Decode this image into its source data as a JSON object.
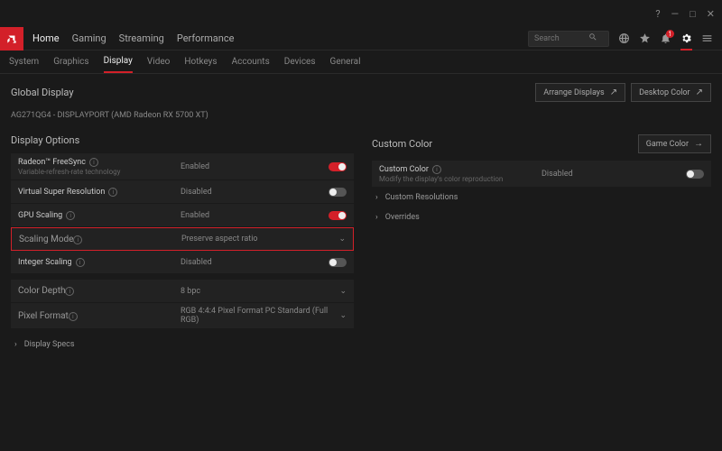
{
  "titlebar": {
    "help": "?",
    "min": "—",
    "max": "□",
    "close": "✕"
  },
  "nav": {
    "items": [
      "Home",
      "Gaming",
      "Streaming",
      "Performance"
    ],
    "activeIndex": 0
  },
  "search": {
    "placeholder": "Search"
  },
  "toolbar": {
    "bell_badge": "1"
  },
  "subnav": {
    "items": [
      "System",
      "Graphics",
      "Display",
      "Video",
      "Hotkeys",
      "Accounts",
      "Devices",
      "General"
    ],
    "activeIndex": 2
  },
  "global": {
    "title": "Global Display",
    "arrange": "Arrange Displays",
    "desktop_color": "Desktop Color",
    "display_name": "AG271QG4 - DISPLAYPORT (AMD Radeon RX 5700 XT)"
  },
  "left": {
    "title": "Display Options",
    "freesync": {
      "label": "Radeon™ FreeSync",
      "sub": "Variable-refresh-rate technology",
      "status": "Enabled",
      "on": true
    },
    "vsr": {
      "label": "Virtual Super Resolution",
      "status": "Disabled",
      "on": false
    },
    "gpuscaling": {
      "label": "GPU Scaling",
      "status": "Enabled",
      "on": true
    },
    "scalingmode": {
      "label": "Scaling Mode",
      "value": "Preserve aspect ratio"
    },
    "intscaling": {
      "label": "Integer Scaling",
      "status": "Disabled",
      "on": false
    },
    "colordepth": {
      "label": "Color Depth",
      "value": "8 bpc"
    },
    "pixelfmt": {
      "label": "Pixel Format",
      "value": "RGB 4:4:4 Pixel Format PC Standard (Full RGB)"
    },
    "specs": "Display Specs"
  },
  "right": {
    "title": "Custom Color",
    "game_color": "Game Color",
    "customcolor": {
      "label": "Custom Color",
      "sub": "Modify the display's color reproduction",
      "status": "Disabled",
      "on": false
    },
    "custom_res": "Custom Resolutions",
    "overrides": "Overrides"
  }
}
